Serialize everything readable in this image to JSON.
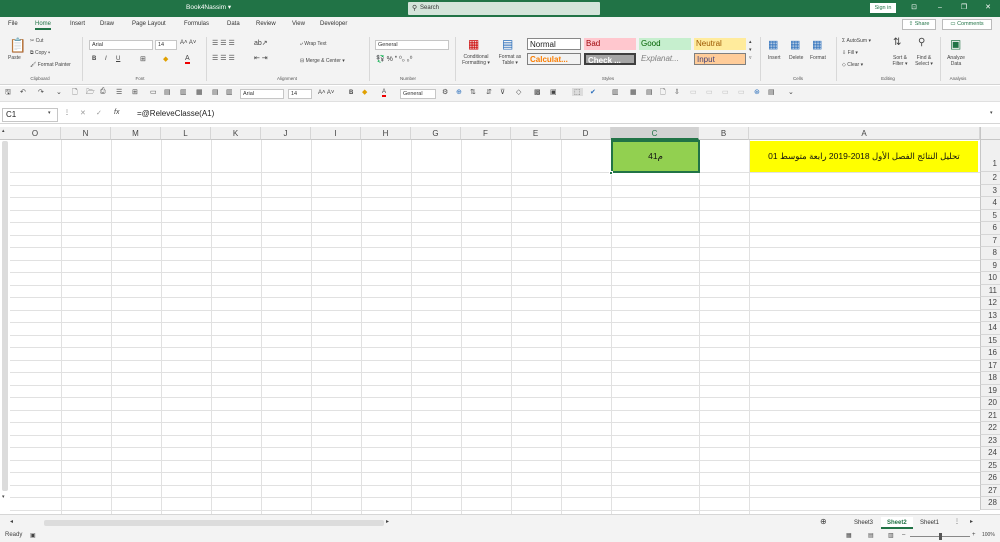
{
  "window": {
    "title": "Book4Nassim  ▾",
    "search_placeholder": "Search",
    "signin_label": "Sign in",
    "ribbon_display": "⊡",
    "minimize": "–",
    "restore": "❐",
    "close": "✕"
  },
  "tabs": [
    "File",
    "Home",
    "Insert",
    "Draw",
    "Page Layout",
    "Formulas",
    "Data",
    "Review",
    "View",
    "Developer"
  ],
  "share_label": "Share",
  "comments_label": "Comments",
  "ribbon": {
    "clipboard": {
      "paste": "Paste",
      "cut": "Cut",
      "copy": "Copy  ▾",
      "format_painter": "Format Painter",
      "label": "Clipboard"
    },
    "font": {
      "name": "Arial",
      "size": "14",
      "label": "Font"
    },
    "alignment": {
      "wrap": "Wrap Text",
      "merge": "Merge & Center  ▾",
      "label": "Alignment"
    },
    "number": {
      "format": "General",
      "label": "Number"
    },
    "styles": {
      "conditional": "Conditional Formatting ▾",
      "format_table": "Format as Table ▾",
      "normal": "Normal",
      "bad": "Bad",
      "good": "Good",
      "neutral": "Neutral",
      "calculation": "Calculat...",
      "check": "Check ...",
      "explanatory": "Explanat...",
      "input": "Input",
      "label": "Styles"
    },
    "cells": {
      "insert": "Insert",
      "delete": "Delete",
      "format": "Format",
      "label": "Cells"
    },
    "editing": {
      "autosum": "AutoSum  ▾",
      "fill": "Fill ▾",
      "clear": "Clear ▾",
      "sort": "Sort & Filter ▾",
      "find": "Find & Select ▾",
      "label": "Editing"
    },
    "analysis": {
      "analyze": "Analyze Data",
      "label": "Analysis"
    }
  },
  "qat": {
    "font": "Arial",
    "size": "14",
    "format": "General"
  },
  "formula_bar": {
    "name_box": "C1",
    "formula": "=@ReleveClasse(A1)",
    "cancel": "✕",
    "enter": "✓",
    "fx": "fx"
  },
  "columns": [
    "O",
    "N",
    "M",
    "L",
    "K",
    "J",
    "I",
    "H",
    "G",
    "F",
    "E",
    "D",
    "C",
    "B",
    "A"
  ],
  "rows": [
    "1",
    "2",
    "3",
    "4",
    "5",
    "6",
    "7",
    "8",
    "9",
    "10",
    "11",
    "12",
    "13",
    "14",
    "15",
    "16",
    "17",
    "18",
    "19",
    "20",
    "21",
    "22",
    "23",
    "24",
    "25",
    "26",
    "27",
    "28"
  ],
  "cells": {
    "A1": "تحليل النتائج الفصل الأول 2018-2019 رابعة متوسط 01",
    "C1": "4م1"
  },
  "sheets": [
    "Sheet3",
    "Sheet2",
    "Sheet1"
  ],
  "active_sheet": "Sheet2",
  "status": {
    "ready": "Ready",
    "zoom": "100%"
  },
  "colors": {
    "excel_green": "#217346",
    "a1_fill": "#ffff00",
    "c1_fill": "#92d050"
  }
}
